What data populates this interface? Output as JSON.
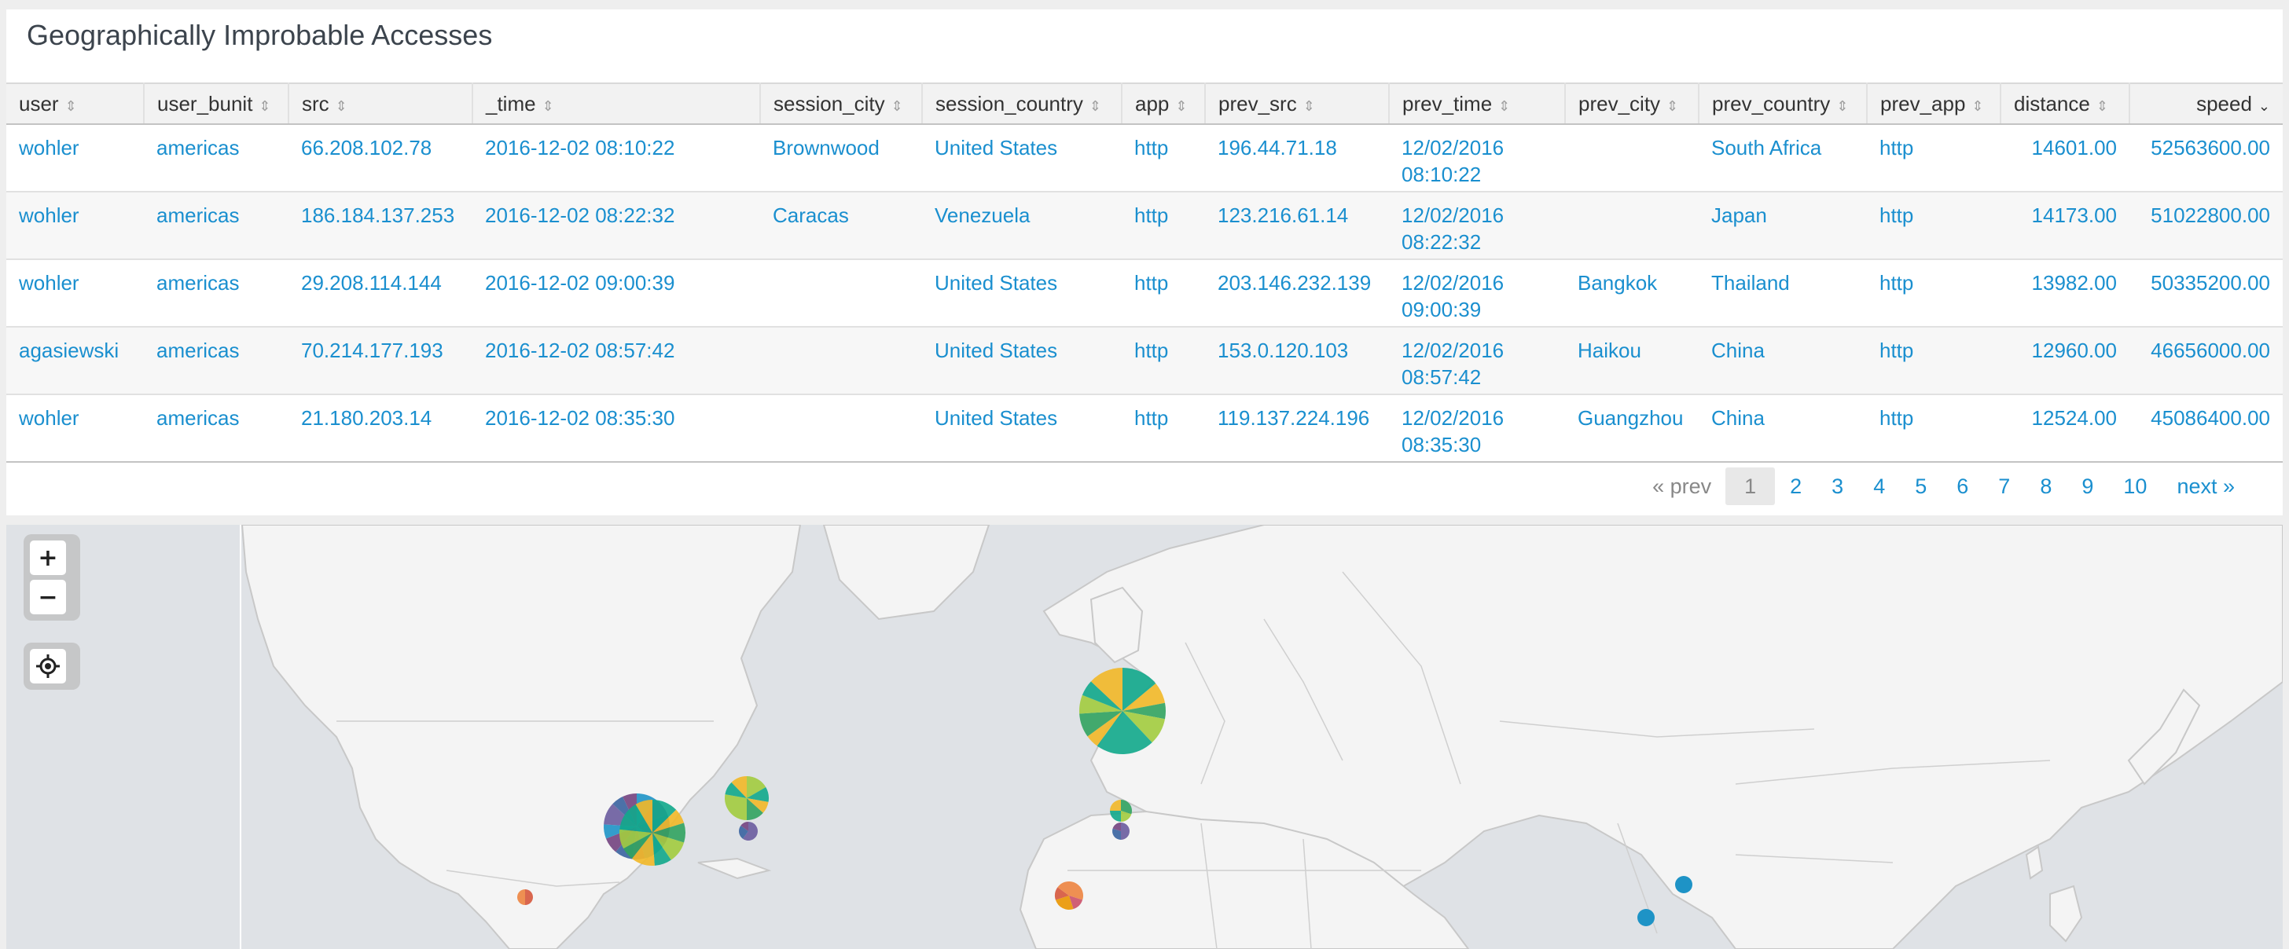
{
  "panel": {
    "title": "Geographically Improbable Accesses"
  },
  "table": {
    "columns": [
      "user",
      "user_bunit",
      "src",
      "_time",
      "session_city",
      "session_country",
      "app",
      "prev_src",
      "prev_time",
      "prev_city",
      "prev_country",
      "prev_app",
      "distance",
      "speed"
    ],
    "sorted_column": "speed",
    "sort_direction": "descending",
    "rows": [
      [
        "wohler",
        "americas",
        "66.208.102.78",
        "2016-12-02 08:10:22",
        "Brownwood",
        "United States",
        "http",
        "196.44.71.18",
        "12/02/2016 08:10:22",
        "",
        "South Africa",
        "http",
        "14601.00",
        "52563600.00"
      ],
      [
        "wohler",
        "americas",
        "186.184.137.253",
        "2016-12-02 08:22:32",
        "Caracas",
        "Venezuela",
        "http",
        "123.216.61.14",
        "12/02/2016 08:22:32",
        "",
        "Japan",
        "http",
        "14173.00",
        "51022800.00"
      ],
      [
        "wohler",
        "americas",
        "29.208.114.144",
        "2016-12-02 09:00:39",
        "",
        "United States",
        "http",
        "203.146.232.139",
        "12/02/2016 09:00:39",
        "Bangkok",
        "Thailand",
        "http",
        "13982.00",
        "50335200.00"
      ],
      [
        "agasiewski",
        "americas",
        "70.214.177.193",
        "2016-12-02 08:57:42",
        "",
        "United States",
        "http",
        "153.0.120.103",
        "12/02/2016 08:57:42",
        "Haikou",
        "China",
        "http",
        "12960.00",
        "46656000.00"
      ],
      [
        "wohler",
        "americas",
        "21.180.203.14",
        "2016-12-02 08:35:30",
        "",
        "United States",
        "http",
        "119.137.224.196",
        "12/02/2016 08:35:30",
        "Guangzhou",
        "China",
        "http",
        "12524.00",
        "45086400.00"
      ]
    ]
  },
  "pager": {
    "prev_label": "« prev",
    "pages": [
      "1",
      "2",
      "3",
      "4",
      "5",
      "6",
      "7",
      "8",
      "9",
      "10"
    ],
    "current": "1",
    "next_label": "next »"
  },
  "map": {
    "controls": {
      "zoom_in": "+",
      "zoom_out": "−"
    },
    "colors": {
      "water": "#dfe2e6",
      "land": "#f4f4f4",
      "border": "#c8c8c8",
      "single_point": "#1e93c6"
    },
    "pie_palette": [
      "#1e93c6",
      "#f2b827",
      "#d6563c",
      "#6a5c9e",
      "#31a35f",
      "#ed8440",
      "#3863a0",
      "#a2cc3e",
      "#cc5068",
      "#73427f",
      "#11a88b",
      "#ea9600"
    ]
  }
}
